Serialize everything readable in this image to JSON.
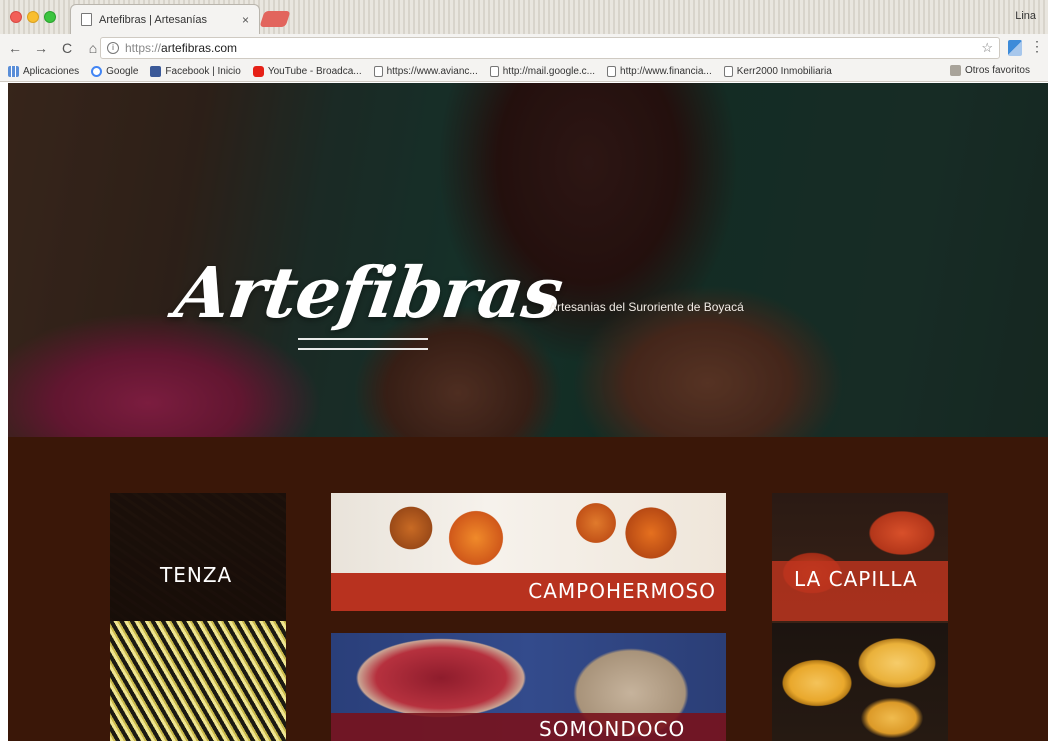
{
  "browser": {
    "tab_title": "Artefibras | Artesanías",
    "tab_close": "×",
    "user_label": "Lina",
    "url_scheme": "https://",
    "url_host": "artefibras.com",
    "nav": {
      "back": "←",
      "forward": "→",
      "reload": "C",
      "home": "⌂"
    },
    "bookmarks": [
      {
        "label": "Aplicaciones",
        "icon": "apps-icon"
      },
      {
        "label": "Google",
        "icon": "google-icon"
      },
      {
        "label": "Facebook | Inicio",
        "icon": "facebook-icon"
      },
      {
        "label": "YouTube - Broadca...",
        "icon": "youtube-icon"
      },
      {
        "label": "https://www.avianc...",
        "icon": "page-icon"
      },
      {
        "label": "http://mail.google.c...",
        "icon": "page-icon"
      },
      {
        "label": "http://www.financia...",
        "icon": "page-icon"
      },
      {
        "label": "Kerr2000 Inmobiliaria",
        "icon": "page-icon"
      }
    ],
    "other_bookmarks": "Otros favoritos"
  },
  "site": {
    "logo_text": "Artefibras",
    "tagline": "Artesanias del Suroriente de Boyacá",
    "products": {
      "tenza": "TENZA",
      "campohermoso": "CAMPOHERMOSO",
      "somondoco": "SOMONDOCO",
      "la_capilla": "LA CAPILLA"
    }
  },
  "colors": {
    "products_bg": "#3a1708",
    "campohermoso_band": "#b8321f",
    "la_capilla_band": "#be341e",
    "somondoco_band": "#78121c"
  }
}
